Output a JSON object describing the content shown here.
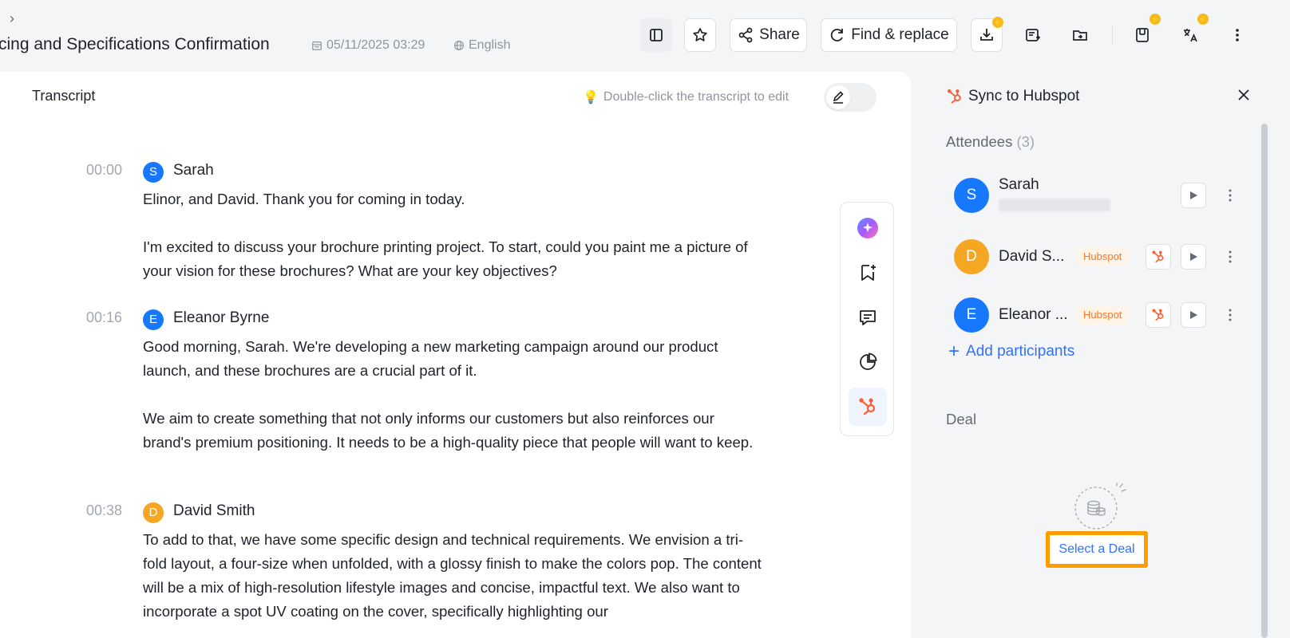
{
  "header": {
    "title": "cing and Specifications Confirmation",
    "date": "05/11/2025 03:29",
    "language": "English",
    "toolbar": {
      "share_label": "Share",
      "find_replace_label": "Find & replace"
    }
  },
  "transcript": {
    "title": "Transcript",
    "hint": "Double-click the transcript to edit",
    "segments": [
      {
        "time": "00:00",
        "initial": "S",
        "speaker": "Sarah",
        "paragraphs": [
          "Elinor, and David. Thank you for coming in today.",
          "I'm excited to discuss your brochure printing project. To start, could you paint me a picture of your vision for these brochures? What are your key objectives?"
        ]
      },
      {
        "time": "00:16",
        "initial": "E",
        "speaker": "Eleanor Byrne",
        "paragraphs": [
          "Good morning, Sarah. We're developing a new marketing campaign around our product launch, and these brochures are a crucial part of it.",
          "We aim to create something that not only informs our customers but also reinforces our brand's premium positioning. It needs to be a high-quality piece that people will want to keep."
        ]
      },
      {
        "time": "00:38",
        "initial": "D",
        "speaker": "David Smith",
        "paragraphs": [
          "To add to that, we have some specific design and technical requirements. We envision a tri-fold layout, a four-size when unfolded, with a glossy finish to make the colors pop. The content will be a mix of high-resolution lifestyle images and concise, impactful text. We also want to incorporate a spot UV coating on the cover, specifically highlighting our"
        ]
      }
    ]
  },
  "hubspot_panel": {
    "title": "Sync to Hubspot",
    "attendees_label": "Attendees",
    "attendees_count": "(3)",
    "attendees": [
      {
        "initial": "S",
        "name": "Sarah",
        "tag": ""
      },
      {
        "initial": "D",
        "name": "David S...",
        "tag": "Hubspot"
      },
      {
        "initial": "E",
        "name": "Eleanor ...",
        "tag": "Hubspot"
      }
    ],
    "add_participants_label": "Add participants",
    "deal_label": "Deal",
    "select_deal_label": "Select a Deal"
  },
  "colors": {
    "accent_blue": "#3370ff",
    "avatar_blue": "#1677ff",
    "avatar_orange": "#f5a623",
    "hubspot_orange": "#ff5c35",
    "highlight_orange": "#ff9d00"
  }
}
